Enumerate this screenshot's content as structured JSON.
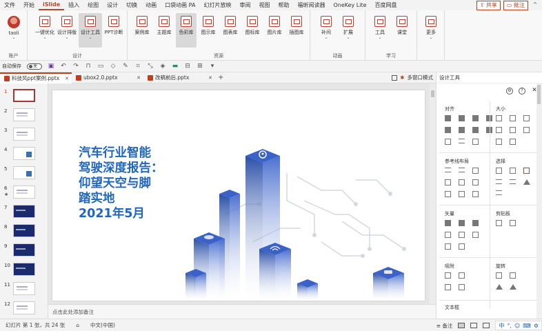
{
  "menu": {
    "items": [
      "文件",
      "开始",
      "iSlide",
      "插入",
      "绘图",
      "设计",
      "切换",
      "动画",
      "口袋动画 PA",
      "幻灯片放映",
      "审阅",
      "视图",
      "帮助",
      "福昕阅读器",
      "OneKey Lite",
      "百度网盘"
    ],
    "active_index": 2,
    "share_label": "共享",
    "comment_label": "批注",
    "collapse_glyph": "^"
  },
  "ribbon": {
    "account": {
      "user": "taoli",
      "group": "账户"
    },
    "design": {
      "group": "设计",
      "buttons": [
        "一键优化",
        "设计排版",
        "设计工具",
        "PPT诊断"
      ],
      "selected": "设计工具"
    },
    "resources": {
      "group": "资源",
      "buttons": [
        "案例库",
        "主题库",
        "色彩库",
        "图示库",
        "图表库",
        "图标库",
        "图片库",
        "插图库"
      ],
      "hover": "色彩库"
    },
    "animation": {
      "group": "动画",
      "buttons": [
        "补间",
        "扩展"
      ]
    },
    "study": {
      "group": "学习",
      "buttons": [
        "工具",
        "课堂"
      ]
    },
    "more": {
      "buttons": [
        "更多"
      ]
    }
  },
  "qat": {
    "autosave_label": "自动保存",
    "toggle_state": "关"
  },
  "tabs": [
    {
      "label": "科技风ppt案例.pptx",
      "active": true
    },
    {
      "label": "ubox2.0.pptx",
      "active": false
    },
    {
      "label": "改稿前后.pptx",
      "active": false
    }
  ],
  "tab_add": "+",
  "multiwindow_label": "多窗口模式",
  "thumbnails": [
    {
      "num": "1",
      "style": "cur"
    },
    {
      "num": "2",
      "style": "light"
    },
    {
      "num": "3",
      "style": "light"
    },
    {
      "num": "4",
      "style": "blue"
    },
    {
      "num": "5",
      "style": "blue"
    },
    {
      "num": "6",
      "style": "light",
      "star": "★"
    },
    {
      "num": "7",
      "style": "dark"
    },
    {
      "num": "8",
      "style": "dark"
    },
    {
      "num": "9",
      "style": "dark"
    },
    {
      "num": "10",
      "style": "dark"
    },
    {
      "num": "11",
      "style": "light"
    },
    {
      "num": "12",
      "style": "light"
    }
  ],
  "slide": {
    "title": "汽车行业智能\n驾驶深度报告：\n仰望天空与脚\n踏实地\n2021年5月"
  },
  "notes_placeholder": "点击此处添加备注",
  "panel": {
    "title": "设计工具",
    "sections": {
      "align": "对齐",
      "size": "大小",
      "guides": "参考线布局",
      "select": "选择",
      "vector": "矢量",
      "clipboard": "剪贴板",
      "snap": "吸附",
      "rotate": "旋转",
      "textbox": "文本框"
    }
  },
  "status": {
    "slide_info": "幻灯片 第 1 张，共 24 张",
    "language": "中文(中国)",
    "notes_label": "备注"
  },
  "ime": [
    "中",
    "°,",
    "☺",
    "⌨",
    "⚙"
  ],
  "colors": {
    "accent": "#b7472a",
    "title_blue": "#1f66c1",
    "art_blue": "#2a4fa8"
  }
}
